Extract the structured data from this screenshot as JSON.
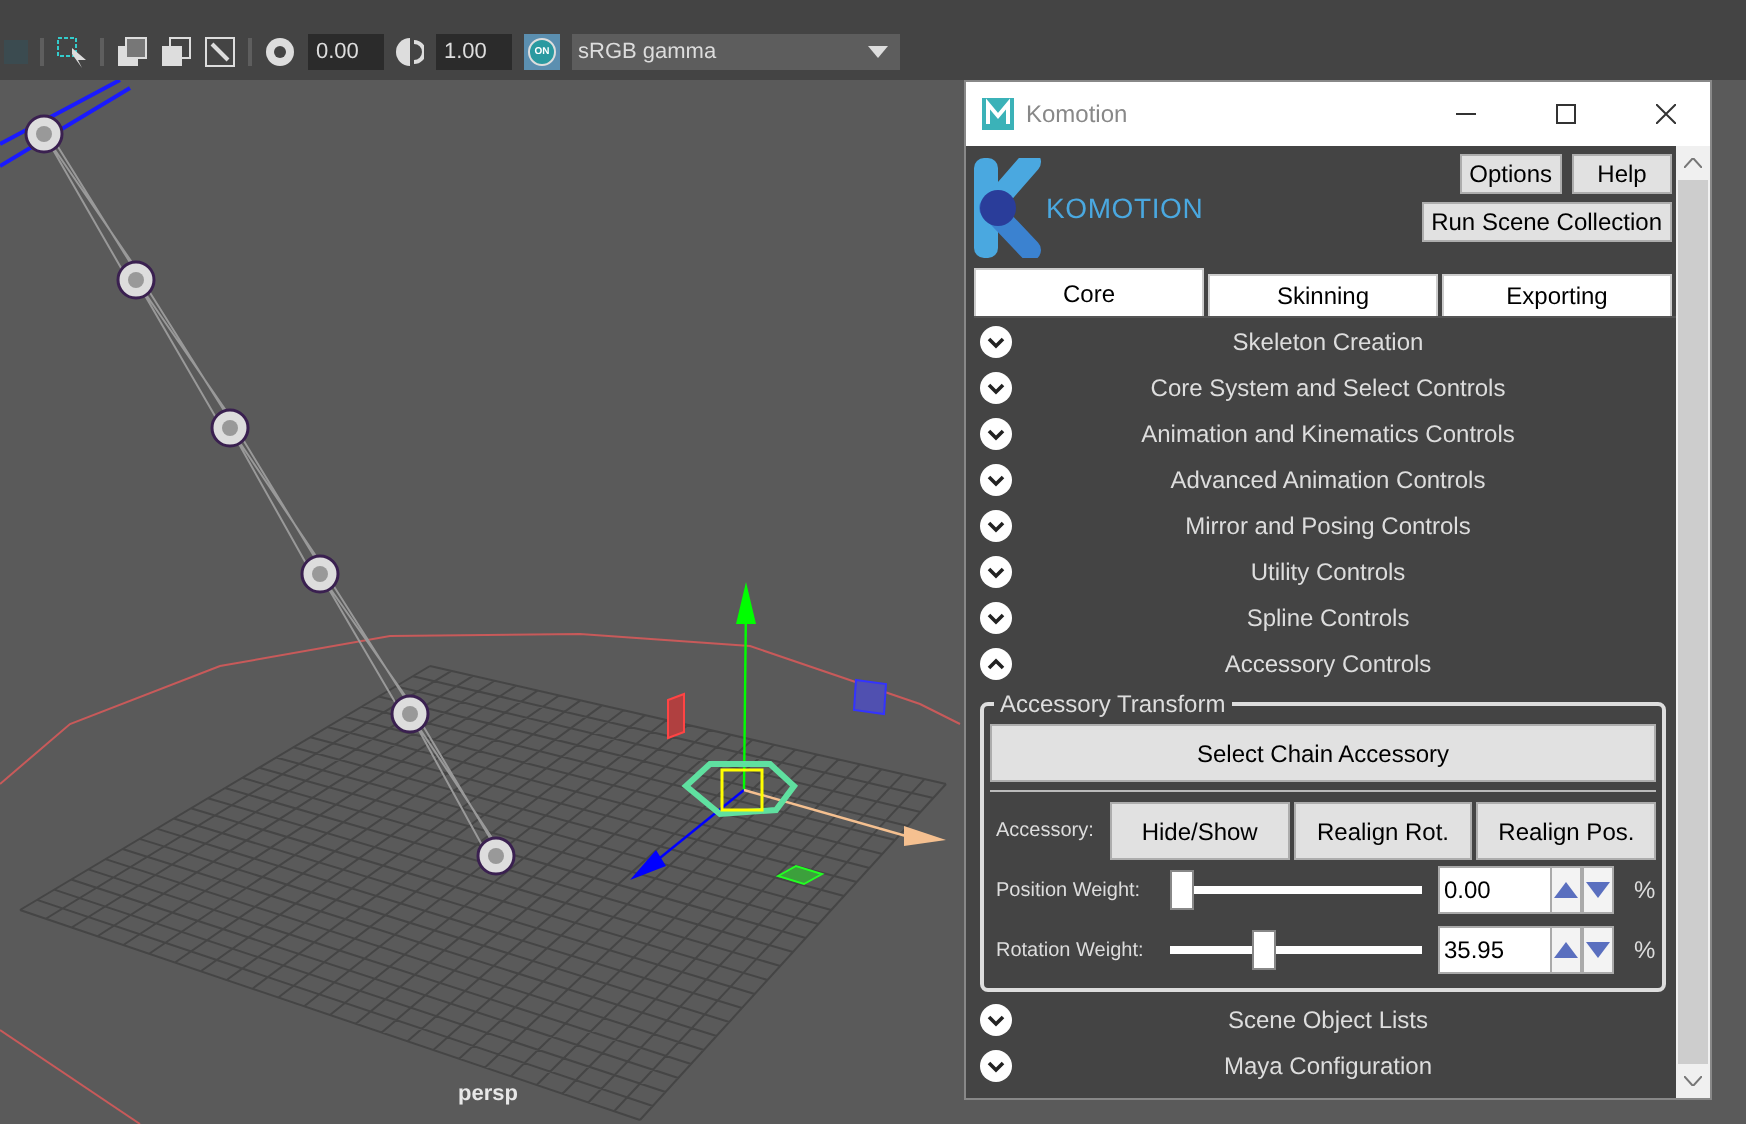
{
  "toolbar": {
    "exposure": "0.00",
    "gamma": "1.00",
    "toggle": "ON",
    "color_space": "sRGB gamma"
  },
  "viewport": {
    "camera_label": "persp"
  },
  "window": {
    "title": "Komotion",
    "logo_text": "KOMOTION",
    "buttons": [
      "Options",
      "Help",
      "Run Scene Collection"
    ],
    "tabs": [
      {
        "label": "Core",
        "selected": true
      },
      {
        "label": "Skinning",
        "selected": false
      },
      {
        "label": "Exporting",
        "selected": false
      }
    ],
    "sections": [
      {
        "label": "Skeleton Creation",
        "expanded": false
      },
      {
        "label": "Core System and Select Controls",
        "expanded": false
      },
      {
        "label": "Animation and Kinematics Controls",
        "expanded": false
      },
      {
        "label": "Advanced Animation Controls",
        "expanded": false
      },
      {
        "label": "Mirror and Posing Controls",
        "expanded": false
      },
      {
        "label": "Utility Controls",
        "expanded": false
      },
      {
        "label": "Spline Controls",
        "expanded": false
      },
      {
        "label": "Accessory Controls",
        "expanded": true
      },
      {
        "label": "Scene Object Lists",
        "expanded": false
      },
      {
        "label": "Maya Configuration",
        "expanded": false
      }
    ],
    "group": {
      "title": "Accessory Transform",
      "primary_button": "Select Chain Accessory",
      "accessory_label": "Accessory:",
      "accessory_buttons": [
        "Hide/Show",
        "Realign Rot.",
        "Realign Pos."
      ],
      "weights": [
        {
          "label": "Position Weight:",
          "level": 0,
          "value": "0.00",
          "unit": "%"
        },
        {
          "label": "Rotation Weight:",
          "level": 0.3595,
          "value": "35.95",
          "unit": "%"
        }
      ]
    }
  }
}
